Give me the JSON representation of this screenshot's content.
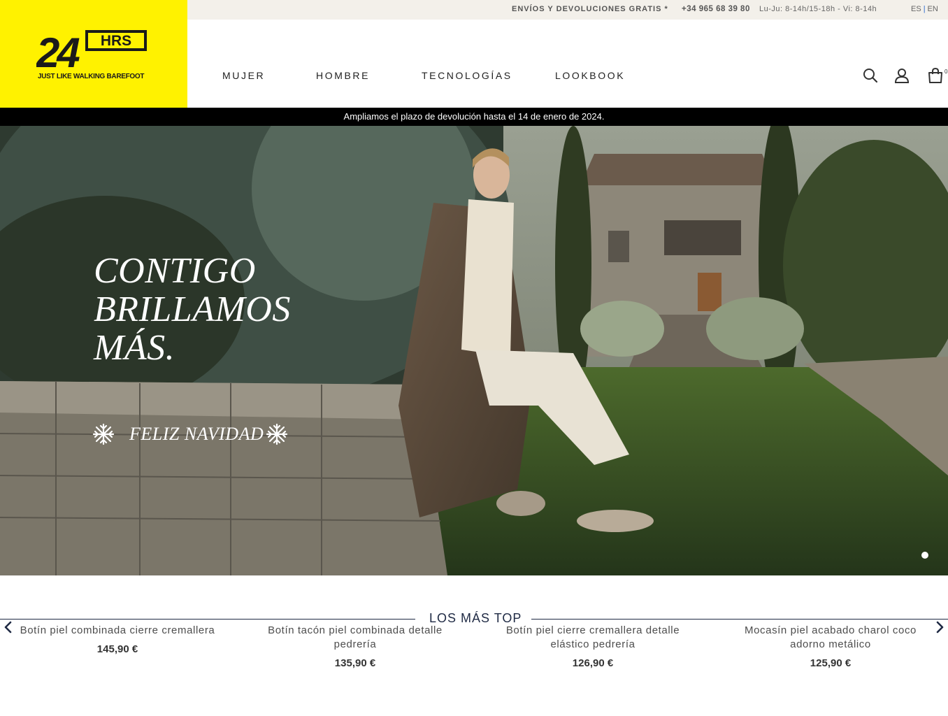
{
  "topbar": {
    "shipping": "ENVÍOS Y DEVOLUCIONES GRATIS *",
    "phone": "+34 965 68 39 80",
    "hours": "Lu-Ju: 8-14h/15-18h - Vi: 8-14h",
    "lang_es": "ES",
    "lang_sep": "|",
    "lang_en": "EN"
  },
  "logo": {
    "number": "24",
    "badge": "HRS",
    "tagline": "JUST LIKE WALKING BAREFOOT",
    "background": "#fff200"
  },
  "nav": {
    "items": [
      "MUJER",
      "HOMBRE",
      "TECNOLOGÍAS",
      "LOOKBOOK"
    ],
    "icons": [
      "search-icon",
      "account-icon",
      "cart-icon"
    ],
    "cart_count": "0"
  },
  "announcement": "Ampliamos el plazo de devolución hasta el 14 de enero de 2024.",
  "hero": {
    "headline_1": "CONTIGO",
    "headline_2": "BRILLAMOS",
    "headline_3": "MÁS.",
    "greeting": "FELIZ NAVIDAD",
    "slides": 1,
    "active_slide": 1
  },
  "top_products": {
    "title": "LOS MÁS TOP",
    "items": [
      {
        "name": "Botín piel combinada cierre cremallera",
        "price": "145,90 €"
      },
      {
        "name": "Botín tacón piel combinada detalle pedrería",
        "price": "135,90 €"
      },
      {
        "name": "Botín piel cierre cremallera detalle elástico pedrería",
        "price": "126,90 €"
      },
      {
        "name": "Mocasín piel acabado charol coco adorno metálico",
        "price": "125,90 €"
      }
    ]
  },
  "colors": {
    "brand_yellow": "#fff200",
    "navy": "#1f2a44",
    "topbar_bg": "#f3f0ea"
  }
}
